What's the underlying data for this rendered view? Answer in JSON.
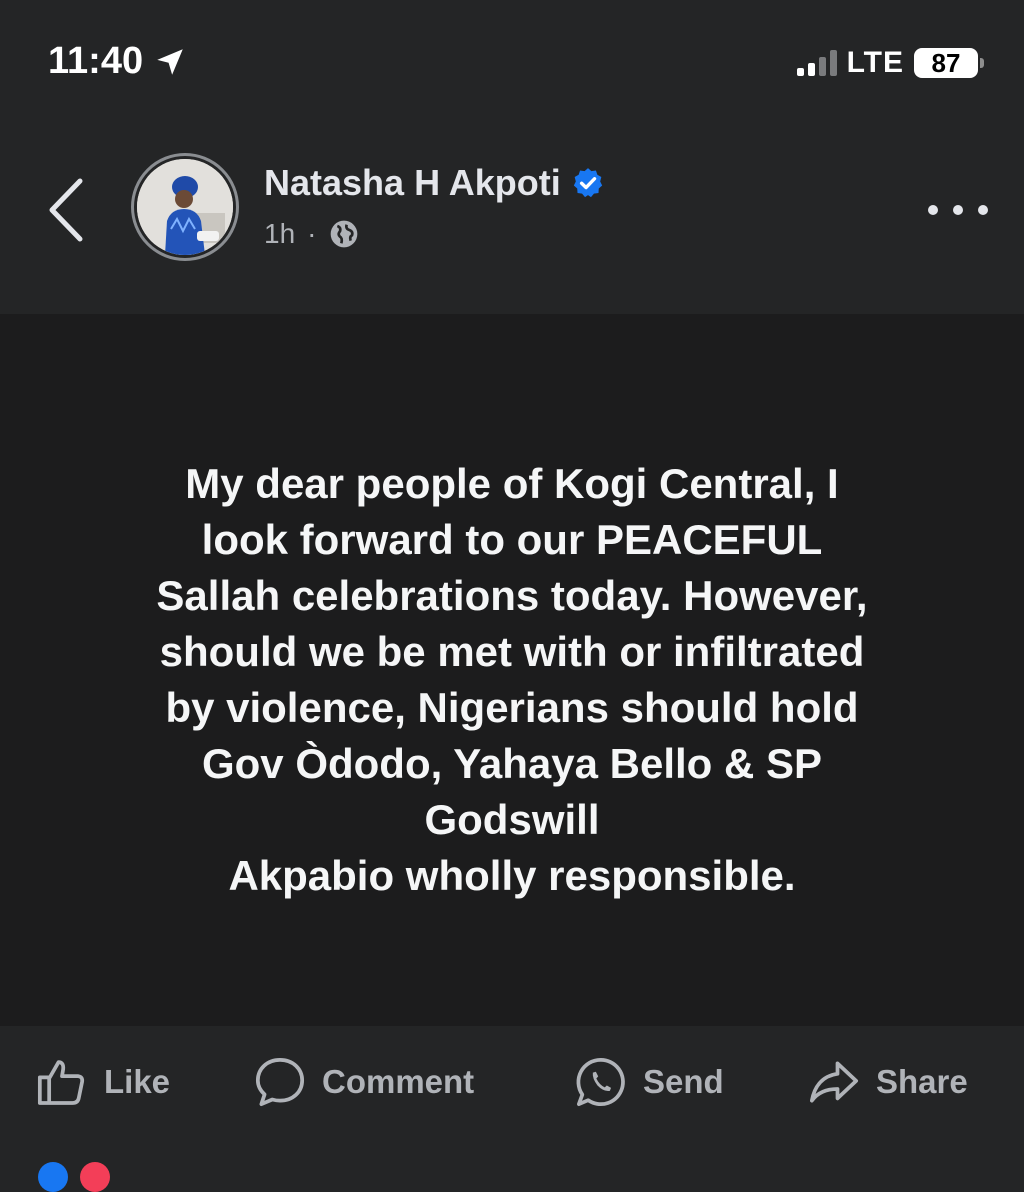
{
  "status_bar": {
    "time": "11:40",
    "network": "LTE",
    "battery": "87"
  },
  "post": {
    "author": "Natasha H Akpoti",
    "time_ago": "1h",
    "separator": "·",
    "verified": true,
    "audience_icon": "globe-icon",
    "text": "My dear people of Kogi Central, I\nlook forward to  our PEACEFUL\nSallah celebrations today. However,\nshould we be met with or infiltrated\nby violence, Nigerians should hold\nGov Òdodo, Yahaya Bello & SP\nGodswill\nAkpabio wholly responsible."
  },
  "actions": {
    "like": "Like",
    "comment": "Comment",
    "send": "Send",
    "share": "Share"
  },
  "colors": {
    "background": "#242526",
    "post_background": "#1c1c1d",
    "text": "#e4e6eb",
    "secondary_text": "#b0b3b8",
    "verified_blue": "#1877f2"
  }
}
